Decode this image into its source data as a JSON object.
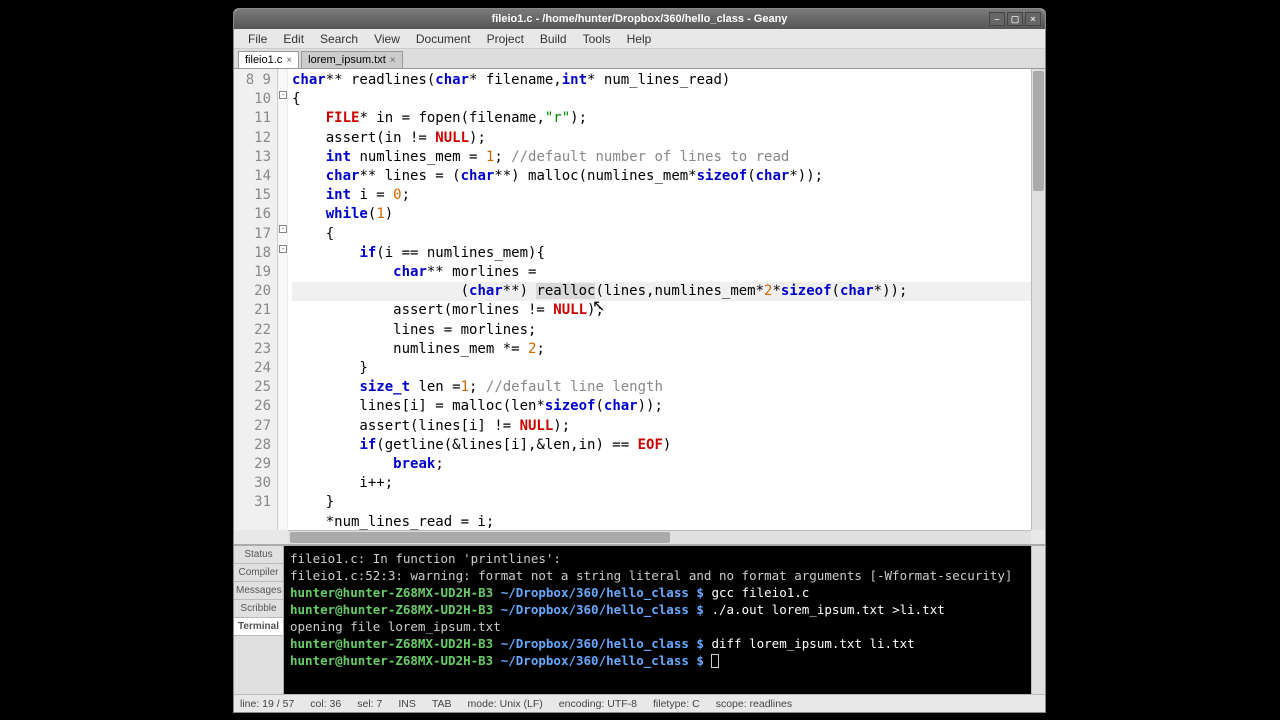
{
  "window": {
    "title": "fileio1.c - /home/hunter/Dropbox/360/hello_class - Geany"
  },
  "menu": [
    "File",
    "Edit",
    "Search",
    "View",
    "Document",
    "Project",
    "Build",
    "Tools",
    "Help"
  ],
  "tabs": [
    {
      "label": "fileio1.c",
      "active": true
    },
    {
      "label": "lorem_ipsum.txt",
      "active": false
    }
  ],
  "code": {
    "first_line": 8,
    "lines": [
      {
        "n": 8,
        "raw": "char** readlines(char* filename,int* num_lines_read)"
      },
      {
        "n": 9,
        "raw": "{"
      },
      {
        "n": 10,
        "raw": "    FILE* in = fopen(filename,\"r\");"
      },
      {
        "n": 11,
        "raw": "    assert(in != NULL);"
      },
      {
        "n": 12,
        "raw": "    int numlines_mem = 1; //default number of lines to read"
      },
      {
        "n": 13,
        "raw": "    char** lines = (char**) malloc(numlines_mem*sizeof(char*));"
      },
      {
        "n": 14,
        "raw": "    int i = 0;"
      },
      {
        "n": 15,
        "raw": "    while(1)"
      },
      {
        "n": 16,
        "raw": "    {"
      },
      {
        "n": 17,
        "raw": "        if(i == numlines_mem){"
      },
      {
        "n": 18,
        "raw": "            char** morlines ="
      },
      {
        "n": 19,
        "raw": "                    (char**) realloc(lines,numlines_mem*2*sizeof(char*));",
        "current": true
      },
      {
        "n": 20,
        "raw": "            assert(morlines != NULL);"
      },
      {
        "n": 21,
        "raw": "            lines = morlines;"
      },
      {
        "n": 22,
        "raw": "            numlines_mem *= 2;"
      },
      {
        "n": 23,
        "raw": "        }"
      },
      {
        "n": 24,
        "raw": "        size_t len =1; //default line length"
      },
      {
        "n": 25,
        "raw": "        lines[i] = malloc(len*sizeof(char));"
      },
      {
        "n": 26,
        "raw": "        assert(lines[i] != NULL);"
      },
      {
        "n": 27,
        "raw": "        if(getline(&lines[i],&len,in) == EOF)"
      },
      {
        "n": 28,
        "raw": "            break;"
      },
      {
        "n": 29,
        "raw": "        i++;"
      },
      {
        "n": 30,
        "raw": "    }"
      },
      {
        "n": 31,
        "raw": "    *num_lines_read = i;"
      }
    ]
  },
  "sidetabs": [
    "Status",
    "Compiler",
    "Messages",
    "Scribble",
    "Terminal"
  ],
  "terminal": {
    "lines": [
      {
        "t": "plain",
        "text": "fileio1.c: In function 'printlines':"
      },
      {
        "t": "plain",
        "text": "fileio1.c:52:3: warning: format not a string literal and no format arguments [-Wformat-security]"
      },
      {
        "t": "prompt",
        "user": "hunter@hunter-Z68MX-UD2H-B3",
        "path": "~/Dropbox/360/hello_class",
        "cmd": "gcc fileio1.c"
      },
      {
        "t": "prompt",
        "user": "hunter@hunter-Z68MX-UD2H-B3",
        "path": "~/Dropbox/360/hello_class",
        "cmd": "./a.out lorem_ipsum.txt >li.txt"
      },
      {
        "t": "plain",
        "text": "opening file lorem_ipsum.txt"
      },
      {
        "t": "prompt",
        "user": "hunter@hunter-Z68MX-UD2H-B3",
        "path": "~/Dropbox/360/hello_class",
        "cmd": "diff lorem_ipsum.txt li.txt"
      },
      {
        "t": "prompt",
        "user": "hunter@hunter-Z68MX-UD2H-B3",
        "path": "~/Dropbox/360/hello_class",
        "cmd": "",
        "cursor": true
      }
    ]
  },
  "status": {
    "pos": "line: 19 / 57",
    "col": "col: 36",
    "sel": "sel: 7",
    "ins": "INS",
    "tab": "TAB",
    "mode": "mode: Unix (LF)",
    "enc": "encoding: UTF-8",
    "ft": "filetype: C",
    "scope": "scope: readlines"
  }
}
